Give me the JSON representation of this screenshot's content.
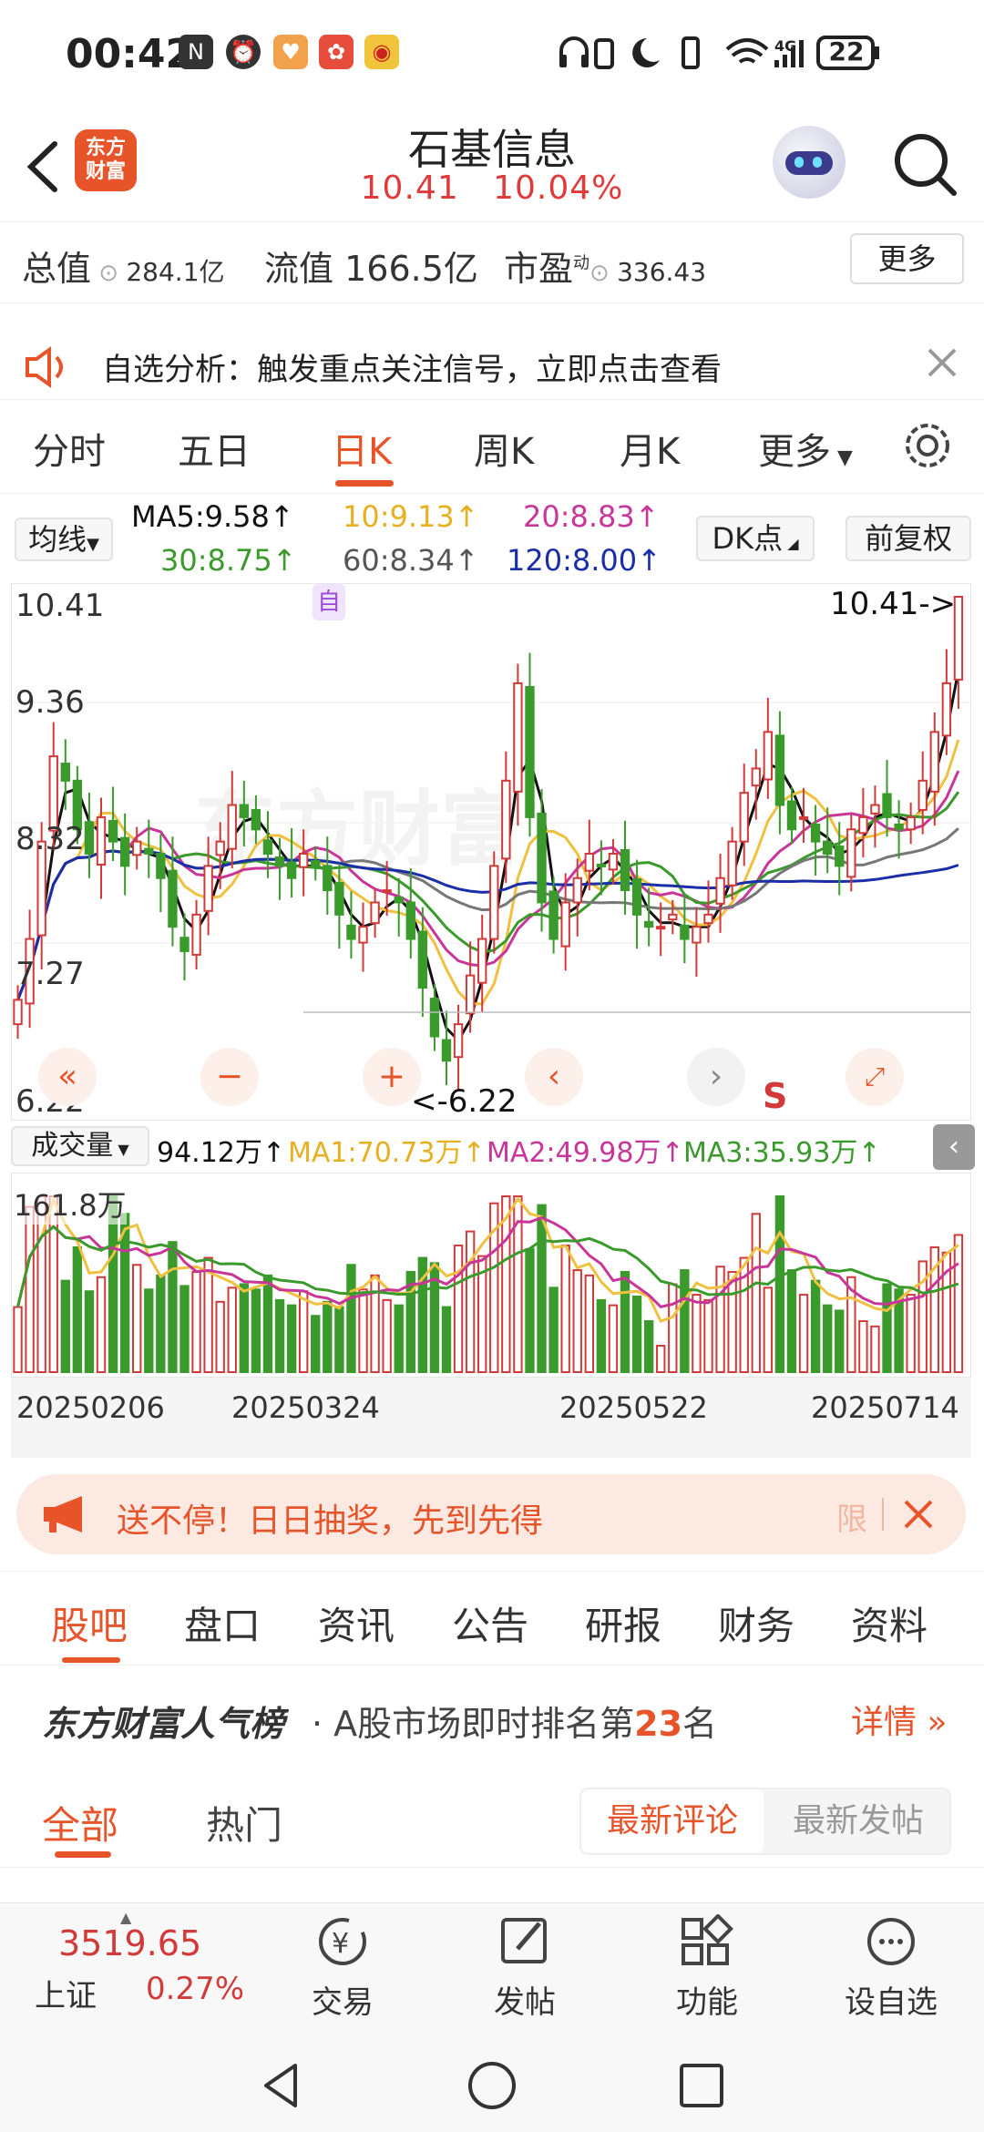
{
  "status": {
    "time": "00:42",
    "battery": "22"
  },
  "header": {
    "title": "石基信息",
    "price": "10.41",
    "change": "10.04%",
    "logo_line1": "东方",
    "logo_line2": "财富"
  },
  "stats": {
    "total_label": "总值",
    "total_value": "284.1亿",
    "float_label": "流值",
    "float_value": "166.5亿",
    "pe_label": "市盈",
    "pe_sup": "动",
    "pe_value": "336.43",
    "more": "更多"
  },
  "banner": {
    "text": "自选分析：触发重点关注信号，立即点击查看"
  },
  "ktabs": [
    "分时",
    "五日",
    "日K",
    "周K",
    "月K",
    "更多"
  ],
  "ma": {
    "btn": "均线",
    "ma5": "MA5:9.58↑",
    "ma10": "10:9.13↑",
    "ma20": "20:8.83↑",
    "ma30": "30:8.75↑",
    "ma60": "60:8.34↑",
    "ma120": "120:8.00↑",
    "dk": "DK点",
    "fq": "前复权"
  },
  "chart_labels": {
    "high": "10.41",
    "y2": "9.36",
    "y3": "8.32",
    "y4": "7.27",
    "low": "6.22",
    "high_marker": "10.41->",
    "low_marker": "<-6.22",
    "zi": "自",
    "s": "S",
    "watermark": "东方财富"
  },
  "colors": {
    "up": "#d23a3a",
    "down": "#3a9a2c",
    "ma5": "#111111",
    "ma10": "#f0c040",
    "ma20": "#c8369a",
    "ma30": "#3a9a2c",
    "ma60": "#777777",
    "ma120": "#1a2ea8",
    "accent": "#e8542a"
  },
  "vol": {
    "btn": "成交量",
    "val": "94.12万↑",
    "ma1": "MA1:70.73万↑",
    "ma2": "MA2:49.98万↑",
    "ma3": "MA3:35.93万↑",
    "max": "161.8万"
  },
  "chart_data": {
    "type": "candlestick",
    "ylim": [
      6.22,
      10.41
    ],
    "ytick_labels": [
      "10.41",
      "9.36",
      "8.32",
      "7.27",
      "6.22"
    ],
    "x_tick_labels": [
      "20250206",
      "20250324",
      "20250522",
      "20250714"
    ],
    "candles_close": [
      7.1,
      7.6,
      8.4,
      9.1,
      8.9,
      8.5,
      8.3,
      8.6,
      8.4,
      8.2,
      8.4,
      8.3,
      8.1,
      7.7,
      7.5,
      7.8,
      8.2,
      8.4,
      8.7,
      8.6,
      8.5,
      8.3,
      8.2,
      8.1,
      8.3,
      8.2,
      8.0,
      7.8,
      7.6,
      7.7,
      7.9,
      8.0,
      7.9,
      7.6,
      7.2,
      6.8,
      6.6,
      6.9,
      7.3,
      7.6,
      8.2,
      8.9,
      9.7,
      8.6,
      7.9,
      7.6,
      7.9,
      8.1,
      8.3,
      8.2,
      8.3,
      8.0,
      7.8,
      7.7,
      7.7,
      7.8,
      7.6,
      7.7,
      7.8,
      8.1,
      8.4,
      8.8,
      9.0,
      9.3,
      8.7,
      8.5,
      8.6,
      8.4,
      8.3,
      8.2,
      8.5,
      8.6,
      8.7,
      8.6,
      8.5,
      8.6,
      8.9,
      9.3,
      9.7,
      10.41
    ],
    "volume_max": "161.8万"
  },
  "promo": {
    "text": "送不停！日日抽奖，先到先得",
    "limit": "限"
  },
  "stabs": [
    "股吧",
    "盘口",
    "资讯",
    "公告",
    "研报",
    "财务",
    "资料"
  ],
  "rank": {
    "brand": "东方财富人气榜",
    "text": "· A股市场即时排名第",
    "num": "23",
    "suffix": "名",
    "detail": "详情"
  },
  "filter": {
    "all": "全部",
    "hot": "热门",
    "latest_comment": "最新评论",
    "latest_post": "最新发帖"
  },
  "bnav": {
    "index_value": "3519.65",
    "index_name": "上证",
    "index_change": "0.27%",
    "trade": "交易",
    "post": "发帖",
    "func": "功能",
    "watch": "设自选"
  }
}
